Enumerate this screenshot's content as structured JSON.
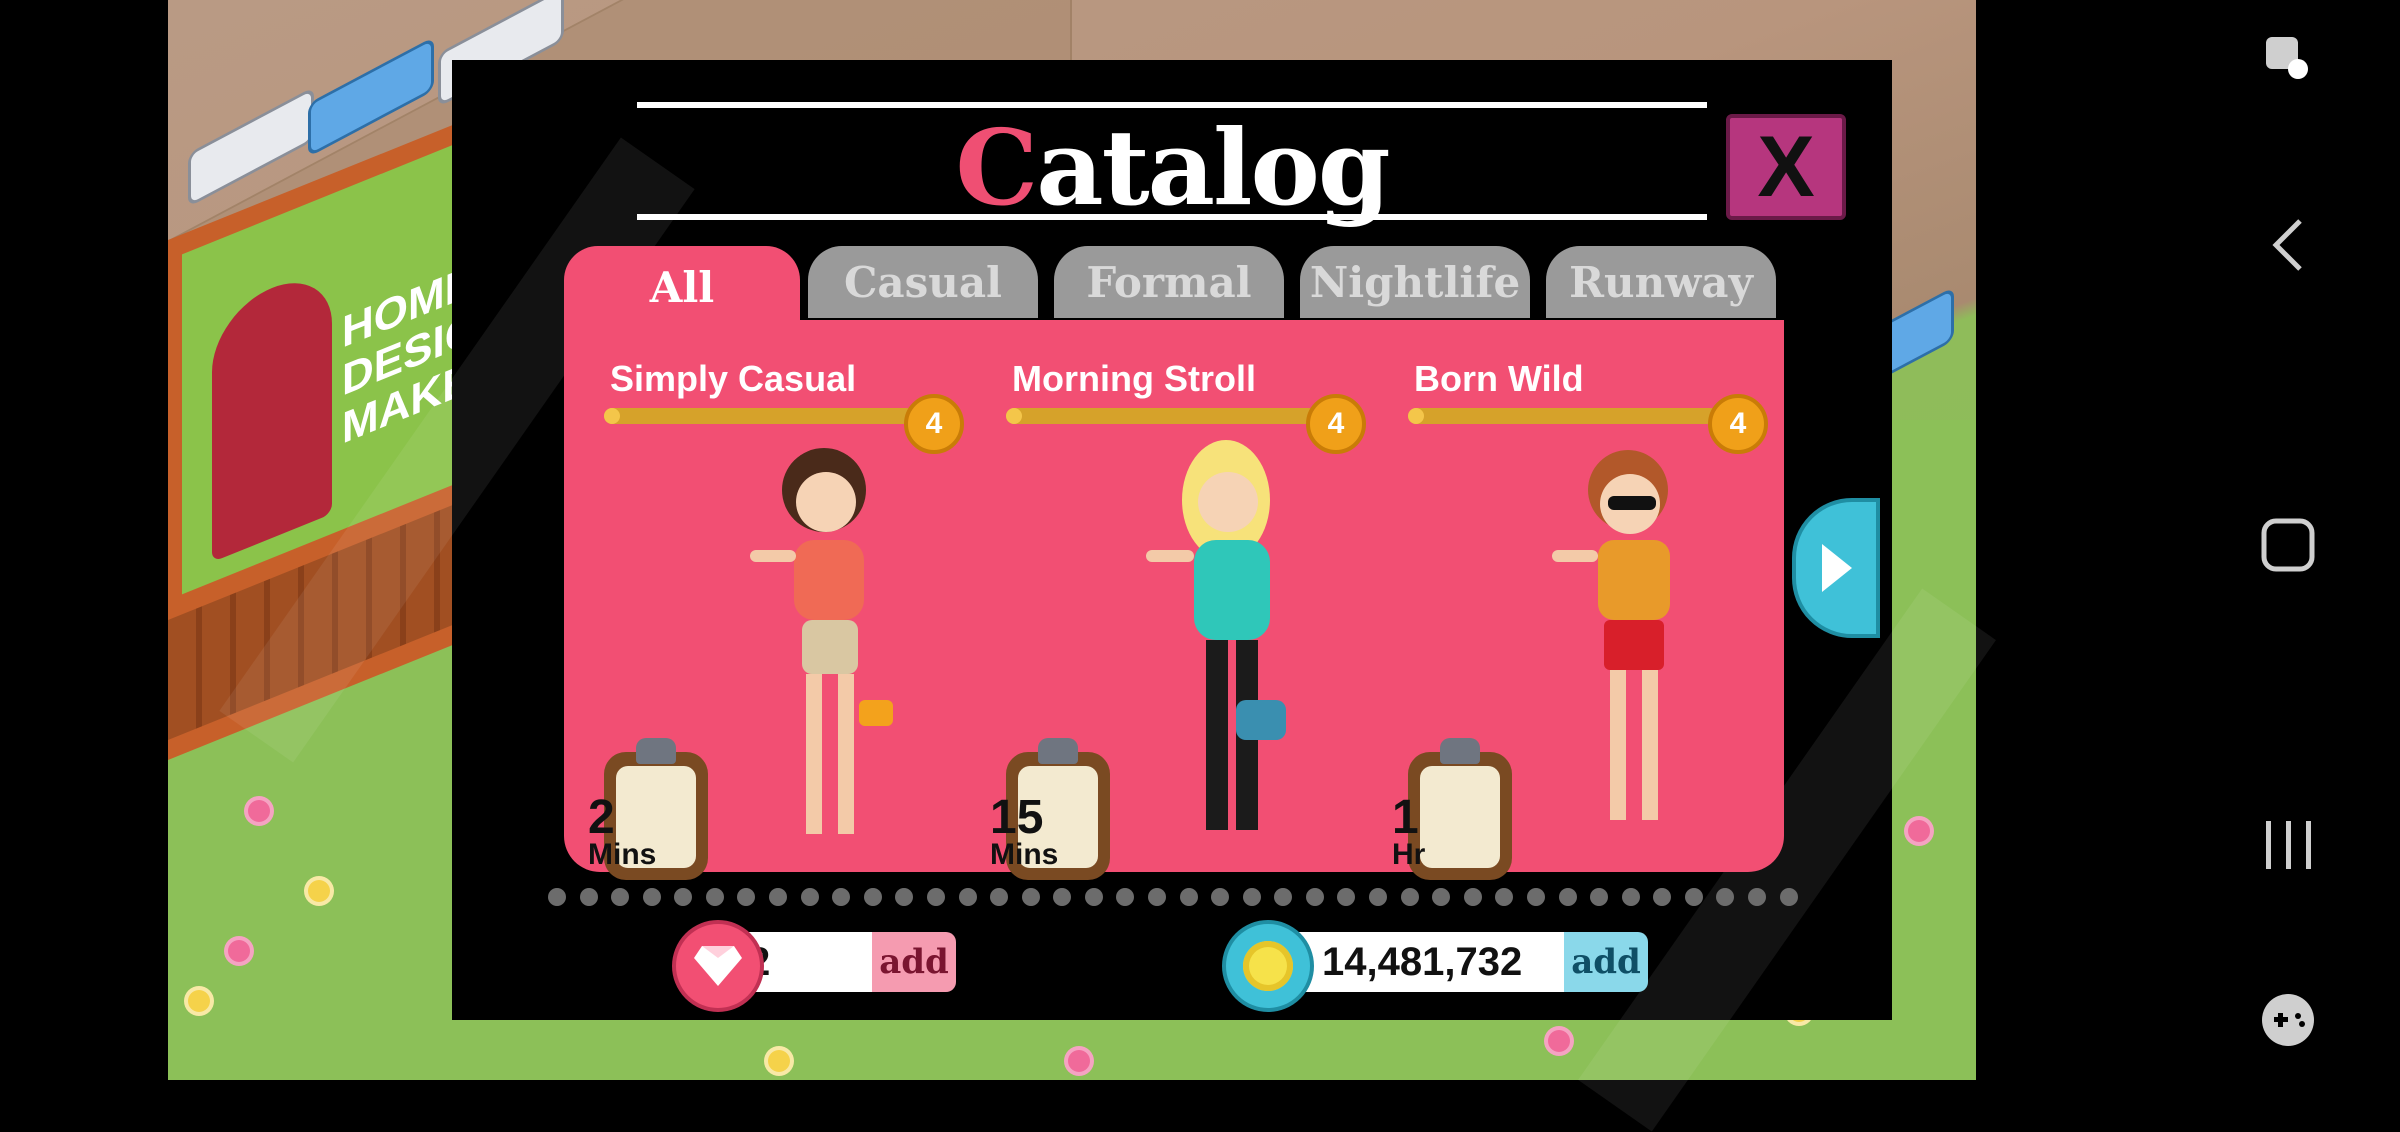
{
  "dialog": {
    "title_first": "C",
    "title_rest": "atalog",
    "close_label": "X"
  },
  "tabs": [
    {
      "label": "All",
      "active": true
    },
    {
      "label": "Casual",
      "active": false
    },
    {
      "label": "Formal",
      "active": false
    },
    {
      "label": "Nightlife",
      "active": false
    },
    {
      "label": "Runway",
      "active": false
    }
  ],
  "outfits": [
    {
      "name": "Simply Casual",
      "level": "4",
      "time_value": "2",
      "time_unit": "Mins",
      "progress": 0.05
    },
    {
      "name": "Morning Stroll",
      "level": "4",
      "time_value": "15",
      "time_unit": "Mins",
      "progress": 0.05
    },
    {
      "name": "Born Wild",
      "level": "4",
      "time_value": "1",
      "time_unit": "Hr",
      "progress": 0.05
    }
  ],
  "currency": {
    "gems": {
      "value": "2",
      "add_label": "add"
    },
    "coins": {
      "value": "14,481,732",
      "add_label": "add"
    }
  },
  "billboard_text": "HOME DESIGN MAKEOVER",
  "colors": {
    "accent_pink": "#f24f73",
    "tab_inactive": "#9a9a9a",
    "close_magenta": "#b6367e",
    "arrow_cyan": "#3fc1d8"
  }
}
